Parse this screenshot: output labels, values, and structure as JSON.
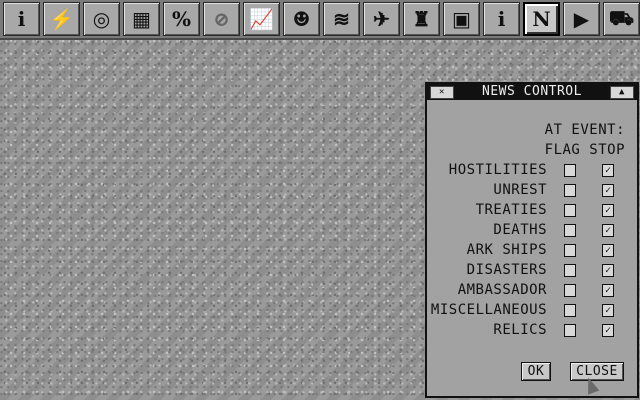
{
  "toolbar": {
    "icons": [
      {
        "name": "info-icon",
        "glyph": "i"
      },
      {
        "name": "lightning-icon",
        "glyph": "⚡"
      },
      {
        "name": "swirl-icon",
        "glyph": "◎"
      },
      {
        "name": "barrier-icon",
        "glyph": "▦"
      },
      {
        "name": "percent-icon",
        "glyph": "%"
      },
      {
        "name": "no-sign-icon",
        "glyph": "⊘"
      },
      {
        "name": "graph-icon",
        "glyph": "📈"
      },
      {
        "name": "person-icon",
        "glyph": "☻"
      },
      {
        "name": "chevron-stack-icon",
        "glyph": "≋"
      },
      {
        "name": "ship-icon",
        "glyph": "✈"
      },
      {
        "name": "tower-icon",
        "glyph": "♜"
      },
      {
        "name": "map-icon",
        "glyph": "▣"
      },
      {
        "name": "info-icon-2",
        "glyph": "i"
      },
      {
        "name": "news-icon",
        "glyph": "N"
      },
      {
        "name": "play-icon",
        "glyph": "▶"
      },
      {
        "name": "ship-2-icon",
        "glyph": "⛟"
      }
    ]
  },
  "dialog": {
    "title": "NEWS CONTROL",
    "close_glyph": "✕",
    "depth_glyph": "▲",
    "header_line1": "AT EVENT:",
    "header_line2": "FLAG STOP",
    "rows": [
      {
        "label": "HOSTILITIES",
        "flag": false,
        "stop": true
      },
      {
        "label": "UNREST",
        "flag": false,
        "stop": true
      },
      {
        "label": "TREATIES",
        "flag": false,
        "stop": true
      },
      {
        "label": "DEATHS",
        "flag": false,
        "stop": true
      },
      {
        "label": "ARK SHIPS",
        "flag": false,
        "stop": true
      },
      {
        "label": "DISASTERS",
        "flag": false,
        "stop": true
      },
      {
        "label": "AMBASSADOR",
        "flag": false,
        "stop": true
      },
      {
        "label": "MISCELLANEOUS",
        "flag": false,
        "stop": true
      },
      {
        "label": "RELICS",
        "flag": false,
        "stop": true
      }
    ],
    "ok_label": "OK",
    "close_label": "CLOSE",
    "check_glyph": "✓"
  }
}
